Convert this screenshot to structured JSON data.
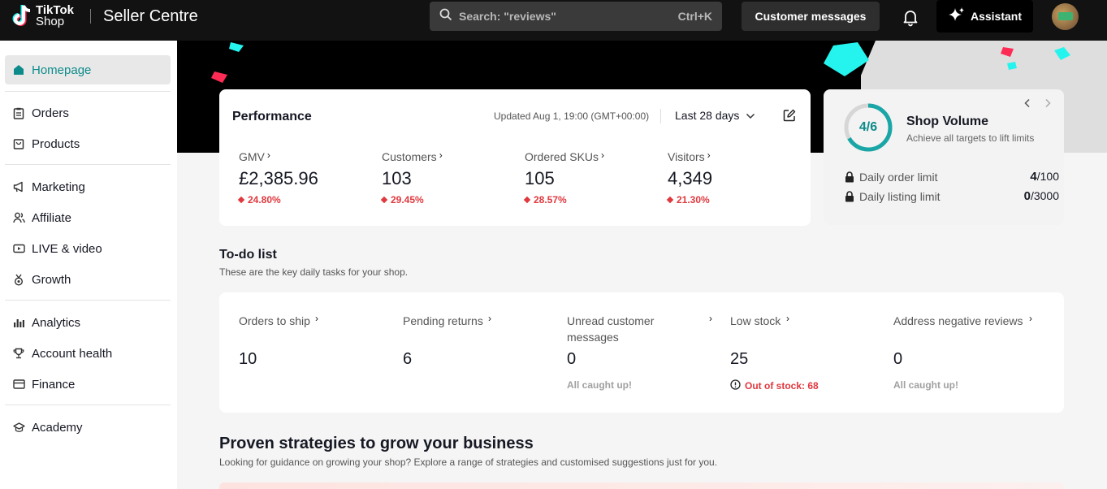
{
  "header": {
    "logo_line1": "TikTok",
    "logo_line2": "Shop",
    "title": "Seller Centre",
    "search_placeholder": "Search: \"reviews\"",
    "search_shortcut": "Ctrl+K",
    "messages_label": "Customer messages",
    "assistant_label": "Assistant",
    "icons": [
      "tiktok-logo-icon",
      "search-icon",
      "bell-icon",
      "sparkle-icon"
    ]
  },
  "sidebar": {
    "items": [
      {
        "label": "Homepage",
        "icon": "home-icon",
        "active": true
      },
      {
        "label": "Orders",
        "icon": "clipboard-icon"
      },
      {
        "label": "Products",
        "icon": "bag-icon"
      },
      {
        "label": "Marketing",
        "icon": "megaphone-icon"
      },
      {
        "label": "Affiliate",
        "icon": "people-icon"
      },
      {
        "label": "LIVE & video",
        "icon": "video-icon"
      },
      {
        "label": "Growth",
        "icon": "medal-icon"
      },
      {
        "label": "Analytics",
        "icon": "bar-chart-icon"
      },
      {
        "label": "Account health",
        "icon": "trophy-icon"
      },
      {
        "label": "Finance",
        "icon": "card-icon"
      },
      {
        "label": "Academy",
        "icon": "graduation-cap-icon"
      }
    ]
  },
  "performance": {
    "title": "Performance",
    "updated": "Updated Aug 1, 19:00 (GMT+00:00)",
    "range": "Last 28 days",
    "metrics": [
      {
        "label": "GMV",
        "value": "£2,385.96",
        "change": "24.80%"
      },
      {
        "label": "Customers",
        "value": "103",
        "change": "29.45%"
      },
      {
        "label": "Ordered SKUs",
        "value": "105",
        "change": "28.57%"
      },
      {
        "label": "Visitors",
        "value": "4,349",
        "change": "21.30%"
      }
    ]
  },
  "shop_volume": {
    "progress": "4/6",
    "progress_fraction": 0.667,
    "title": "Shop Volume",
    "subtitle": "Achieve all targets to lift limits",
    "limits": [
      {
        "label": "Daily order limit",
        "current": "4",
        "max": "/100"
      },
      {
        "label": "Daily listing limit",
        "current": "0",
        "max": "/3000"
      }
    ],
    "accent": "#1aa6a6"
  },
  "todo": {
    "title": "To-do list",
    "subtitle": "These are the key daily tasks for your shop.",
    "tasks": [
      {
        "label": "Orders to ship",
        "value": "10",
        "note": ""
      },
      {
        "label": "Pending returns",
        "value": "6",
        "note": ""
      },
      {
        "label": "Unread customer messages",
        "value": "0",
        "note": "All caught up!"
      },
      {
        "label": "Low stock",
        "value": "25",
        "note": "Out of stock: 68"
      },
      {
        "label": "Address negative reviews",
        "value": "0",
        "note": "All caught up!"
      }
    ]
  },
  "growth": {
    "title": "Proven strategies to grow your business",
    "subtitle": "Looking for guidance on growing your shop? Explore a range of strategies and customised suggestions just for you."
  },
  "colors": {
    "brand_teal": "#0d8b8b",
    "negative": "#e0383e",
    "topbar": "#121212"
  }
}
